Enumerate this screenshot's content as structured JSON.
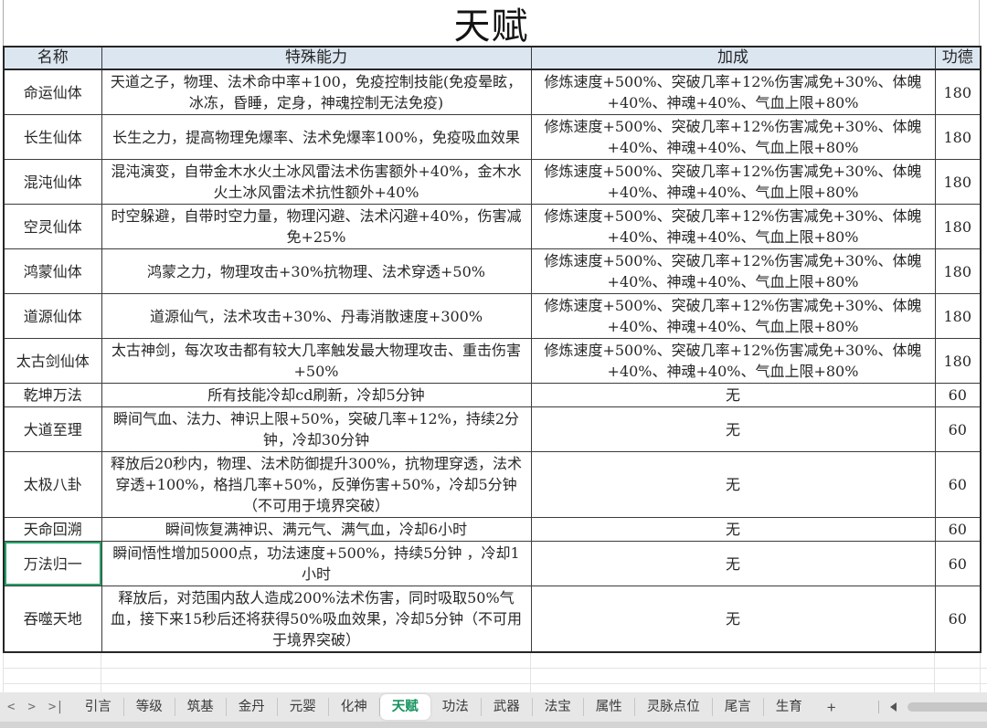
{
  "title": "天赋",
  "columns": [
    "名称",
    "特殊能力",
    "加成",
    "功德"
  ],
  "rows": [
    {
      "name": "命运仙体",
      "ability": "天道之子，物理、法术命中率+100，免疫控制技能(免疫晕眩，冰冻，昏睡，定身，神魂控制无法免疫)",
      "bonus": "修炼速度+500%、突破几率+12%伤害减免+30%、体魄+40%、神魂+40%、气血上限+80%",
      "merit": "180"
    },
    {
      "name": "长生仙体",
      "ability": "长生之力，提高物理免爆率、法术免爆率100%，免疫吸血效果",
      "bonus": "修炼速度+500%、突破几率+12%伤害减免+30%、体魄+40%、神魂+40%、气血上限+80%",
      "merit": "180"
    },
    {
      "name": "混沌仙体",
      "ability": "混沌演变，自带金木水火土冰风雷法术伤害额外+40%，金木水火土冰风雷法术抗性额外+40%",
      "bonus": "修炼速度+500%、突破几率+12%伤害减免+30%、体魄+40%、神魂+40%、气血上限+80%",
      "merit": "180"
    },
    {
      "name": "空灵仙体",
      "ability": "时空躲避，自带时空力量，物理闪避、法术闪避+40%，伤害减免+25%",
      "bonus": "修炼速度+500%、突破几率+12%伤害减免+30%、体魄+40%、神魂+40%、气血上限+80%",
      "merit": "180"
    },
    {
      "name": "鸿蒙仙体",
      "ability": "鸿蒙之力，物理攻击+30%抗物理、法术穿透+50%",
      "bonus": "修炼速度+500%、突破几率+12%伤害减免+30%、体魄+40%、神魂+40%、气血上限+80%",
      "merit": "180"
    },
    {
      "name": "道源仙体",
      "ability": "道源仙气，法术攻击+30%、丹毒消散速度+300%",
      "bonus": "修炼速度+500%、突破几率+12%伤害减免+30%、体魄+40%、神魂+40%、气血上限+80%",
      "merit": "180"
    },
    {
      "name": "太古剑仙体",
      "ability": "太古神剑，每次攻击都有较大几率触发最大物理攻击、重击伤害+50%",
      "bonus": "修炼速度+500%、突破几率+12%伤害减免+30%、体魄+40%、神魂+40%、气血上限+80%",
      "merit": "180"
    },
    {
      "name": "乾坤万法",
      "ability": "所有技能冷却cd刷新，冷却5分钟",
      "bonus": "无",
      "merit": "60"
    },
    {
      "name": "大道至理",
      "ability": "瞬间气血、法力、神识上限+50%，突破几率+12%，持续2分钟，冷却30分钟",
      "bonus": "无",
      "merit": "60"
    },
    {
      "name": "太极八卦",
      "ability": "释放后20秒内，物理、法术防御提升300%，抗物理穿透，法术穿透+100%，格挡几率+50%，反弹伤害+50%，冷却5分钟（不可用于境界突破）",
      "bonus": "无",
      "merit": "60"
    },
    {
      "name": "天命回溯",
      "ability": "瞬间恢复满神识、满元气、满气血，冷却6小时",
      "bonus": "无",
      "merit": "60"
    },
    {
      "name": "万法归一",
      "ability": "瞬间悟性增加5000点，功法速度+500%，持续5分钟 ，冷却1小时",
      "bonus": "无",
      "merit": "60",
      "selected": true
    },
    {
      "name": "吞噬天地",
      "ability": "释放后，对范围内敌人造成200%法术伤害，同时吸取50%气血，接下来15秒后还将获得50%吸血效果，冷却5分钟（不可用于境界突破）",
      "bonus": "无",
      "merit": "60"
    }
  ],
  "tabbar": {
    "nav_prev": "<",
    "nav_next": ">",
    "nav_last": ">|",
    "tabs": [
      {
        "label": "引言"
      },
      {
        "label": "等级"
      },
      {
        "label": "筑基"
      },
      {
        "label": "金丹"
      },
      {
        "label": "元婴"
      },
      {
        "label": "化神"
      },
      {
        "label": "天赋",
        "active": true
      },
      {
        "label": "功法"
      },
      {
        "label": "武器"
      },
      {
        "label": "法宝"
      },
      {
        "label": "属性"
      },
      {
        "label": "灵脉点位"
      },
      {
        "label": "尾言"
      },
      {
        "label": "生育"
      }
    ],
    "add_label": "+"
  },
  "colors": {
    "header_bg": "#dce6f1",
    "active_tab_green": "#15935f",
    "selection_green": "#26a269",
    "tabbar_bg": "#e7e7e7"
  }
}
